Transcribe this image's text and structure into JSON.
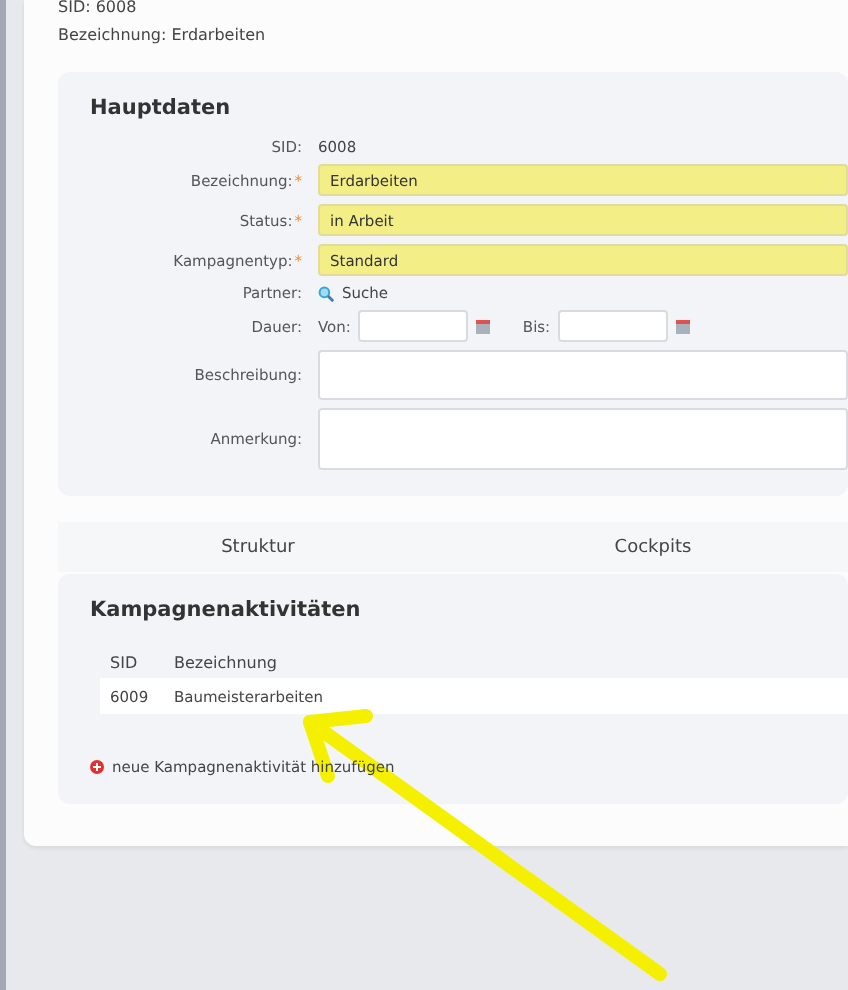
{
  "header": {
    "sid": "SID: 6008",
    "name": "Bezeichnung: Erdarbeiten"
  },
  "main_panel": {
    "title": "Hauptdaten",
    "fields": [
      {
        "kind": "text",
        "label": "SID:",
        "value": "6008"
      },
      {
        "kind": "input",
        "label": "Bezeichnung:",
        "required_mark": "*",
        "value": "Erdarbeiten"
      },
      {
        "kind": "input",
        "label": "Status:",
        "required_mark": "*",
        "value": "in Arbeit"
      },
      {
        "kind": "input",
        "label": "Kampagnentyp:",
        "required_mark": "*",
        "value": "Standard"
      },
      {
        "kind": "search",
        "label": "Partner:",
        "value": "Suche"
      },
      {
        "kind": "daterange",
        "label": "Dauer:",
        "from_label": "Von:",
        "to_label": "Bis:"
      },
      {
        "kind": "textarea",
        "label": "Beschreibung:"
      },
      {
        "kind": "textarea",
        "label": "Anmerkung:"
      }
    ]
  },
  "tabs": [
    {
      "label": "Struktur"
    },
    {
      "label": "Cockpits"
    }
  ],
  "activities": {
    "title": "Kampagnenaktivitäten",
    "columns": [
      "SID",
      "Bezeichnung"
    ],
    "rows": [
      [
        "6009",
        "Baumeisterarbeiten"
      ]
    ],
    "add_link": "neue Kampagnenaktivität hinzufügen"
  }
}
